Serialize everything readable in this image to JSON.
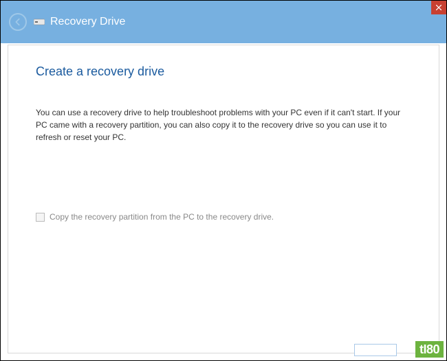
{
  "titlebar": {
    "window_title": "Recovery Drive"
  },
  "content": {
    "heading": "Create a recovery drive",
    "description": "You can use a recovery drive to help troubleshoot problems with your PC even if it can't start. If your PC came with a recovery partition, you can also copy it to the recovery drive so you can use it to refresh or reset your PC."
  },
  "checkbox": {
    "label": "Copy the recovery partition from the PC to the recovery drive.",
    "checked": false,
    "enabled": false
  },
  "watermark": {
    "text": "tI80"
  }
}
